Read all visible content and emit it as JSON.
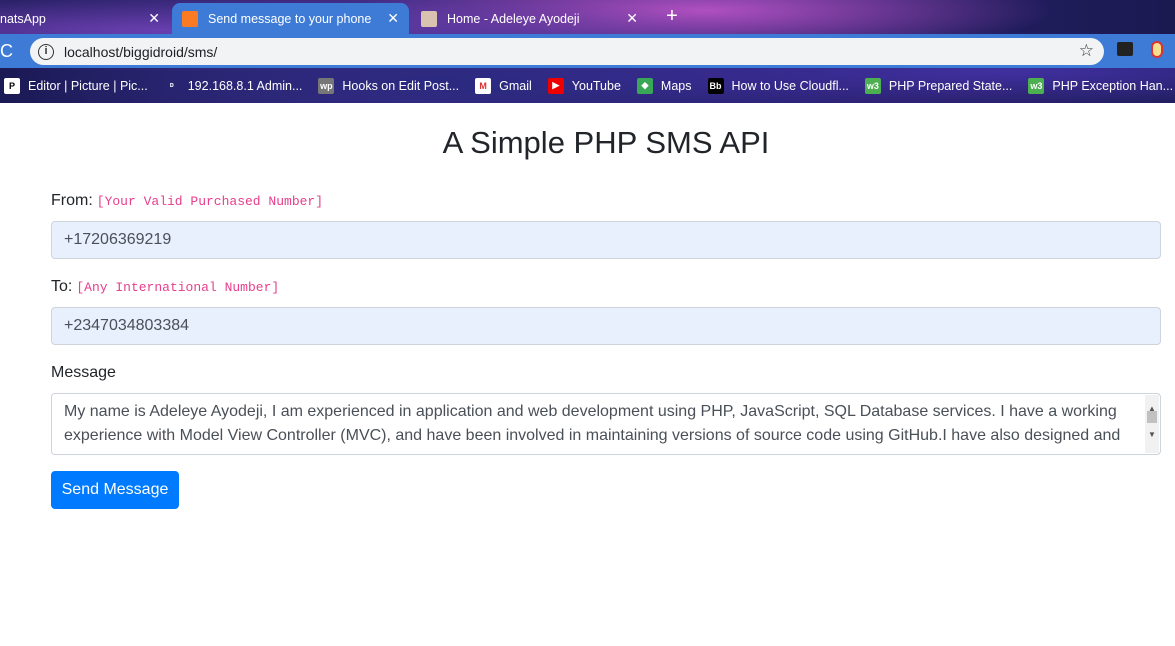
{
  "browser": {
    "tabs": [
      {
        "title": "natsApp",
        "active": false
      },
      {
        "title": "Send message to your phone",
        "active": true
      },
      {
        "title": "Home - Adeleye Ayodeji",
        "active": false
      }
    ],
    "url": "localhost/biggidroid/sms/",
    "bookmarks": [
      {
        "label": "Editor | Picture | Pic...",
        "icon": "pinterest-icon"
      },
      {
        "label": "192.168.8.1 Admin...",
        "icon": "router-icon"
      },
      {
        "label": "Hooks on Edit Post...",
        "icon": "wp-icon"
      },
      {
        "label": "Gmail",
        "icon": "gmail-icon"
      },
      {
        "label": "YouTube",
        "icon": "youtube-icon"
      },
      {
        "label": "Maps",
        "icon": "maps-icon"
      },
      {
        "label": "How to Use Cloudfl...",
        "icon": "bb-icon"
      },
      {
        "label": "PHP Prepared State...",
        "icon": "w3-icon"
      },
      {
        "label": "PHP Exception Han...",
        "icon": "w3-icon"
      }
    ]
  },
  "page": {
    "title": "A Simple PHP SMS API",
    "from_label": "From:",
    "from_hint": "[Your Valid Purchased Number]",
    "from_value": "+17206369219",
    "to_label": "To:",
    "to_hint": "[Any International Number]",
    "to_value": "+2347034803384",
    "message_label": "Message",
    "message_value": "My name is Adeleye Ayodeji, I am experienced in application and web development using PHP, JavaScript, SQL Database services. I have a working experience with Model View Controller (MVC), and have been involved in maintaining versions of source code using GitHub.I have also designed and",
    "button_label": "Send Message"
  },
  "colors": {
    "primary": "#007bff",
    "hint": "#e83e8c",
    "autofill": "#e8f0fe"
  }
}
